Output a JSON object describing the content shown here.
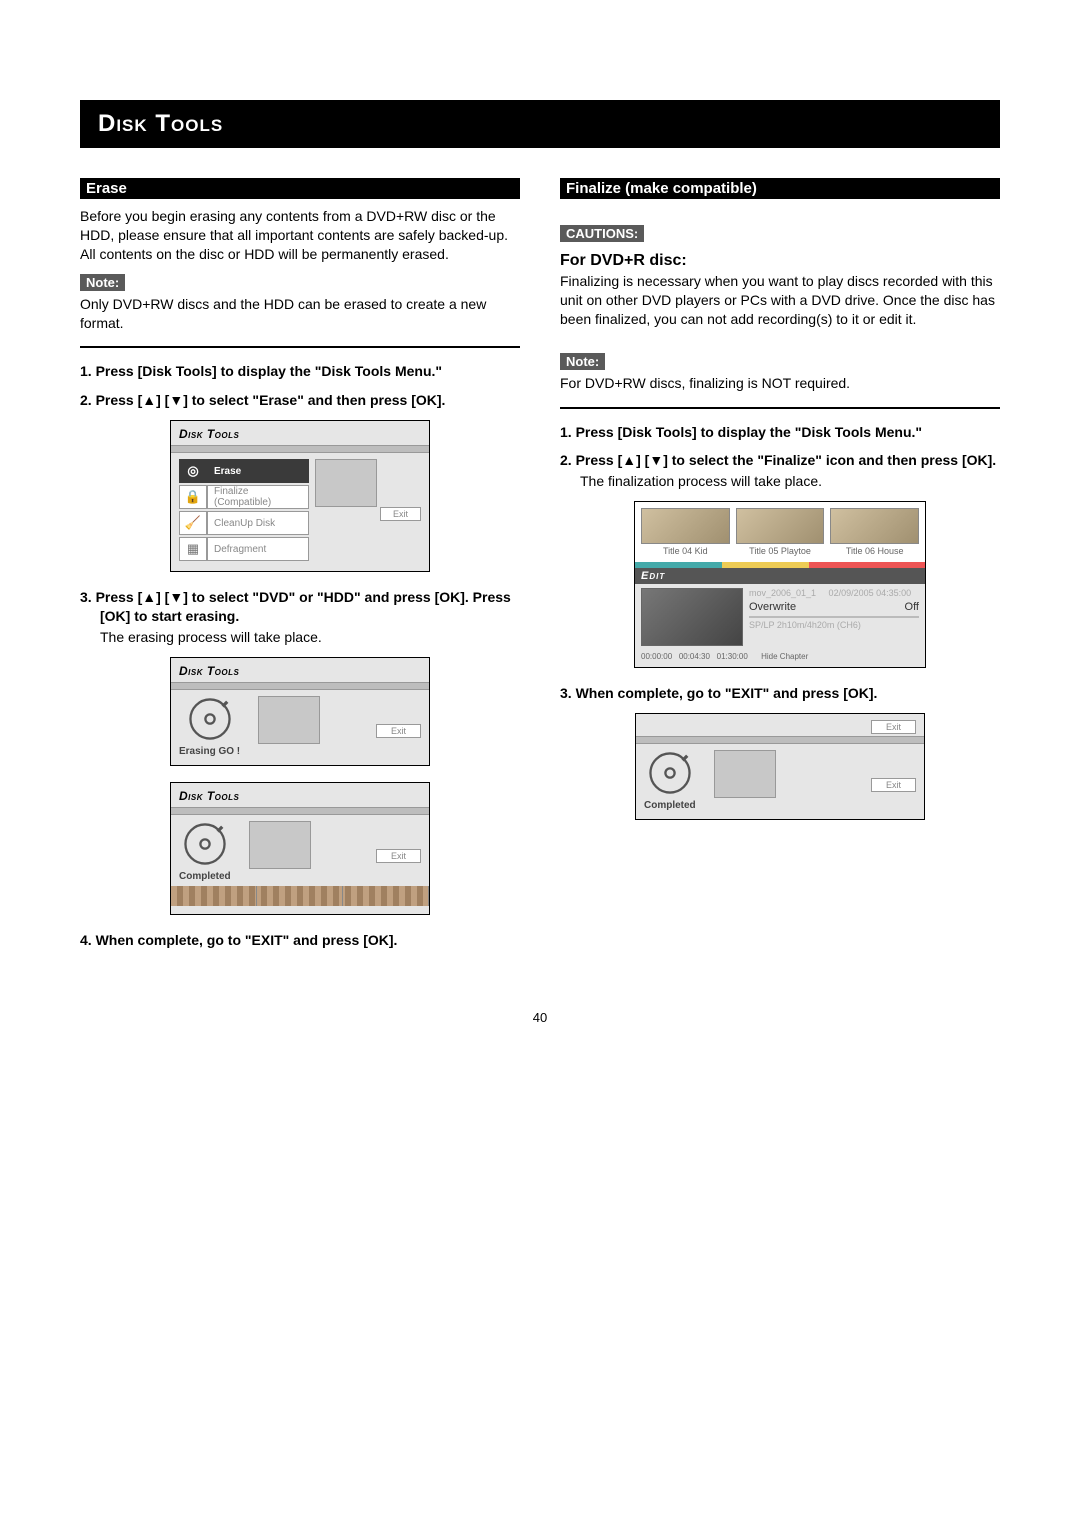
{
  "page_title": "Disk Tools",
  "page_number": "40",
  "erase": {
    "header": "Erase",
    "intro": "Before you begin erasing any contents from a DVD+RW disc or the HDD, please ensure that all important contents are safely backed-up. All contents on the disc or HDD will be permanently erased.",
    "note_label": "Note:",
    "note_text": "Only DVD+RW discs and the HDD can be erased to create a new format.",
    "steps": {
      "s1": "1.  Press [Disk Tools] to display the \"Disk Tools Menu.\"",
      "s2": "2.  Press [▲]  [▼] to select \"Erase\" and then press [OK].",
      "s3": "3.  Press  [▲]  [▼] to select \"DVD\" or \"HDD\" and press [OK].  Press [OK] to start erasing.",
      "s3_sub": "The erasing process will take place.",
      "s4": "4.  When complete, go to \"EXIT\" and press [OK]."
    },
    "ui_menu": {
      "title": "Disk Tools",
      "items": {
        "erase": "Erase",
        "finalize": "Finalize (Compatible)",
        "cleanup": "CleanUp Disk",
        "defrag": "Defragment"
      },
      "exit": "Exit"
    },
    "ui_status": {
      "title": "Disk Tools",
      "erasing": "Erasing GO !",
      "completed": "Completed",
      "exit": "Exit"
    }
  },
  "finalize": {
    "header": "Finalize (make compatible)",
    "cautions_label": "CAUTIONS:",
    "sub_heading": "For DVD+R disc:",
    "body": "Finalizing is necessary when you want to play discs recorded with this unit on other DVD players or PCs with a DVD drive. Once the disc has been finalized, you can not add recording(s) to it or edit it.",
    "note_label": "Note:",
    "note_text": "For DVD+RW discs, finalizing is NOT required.",
    "steps": {
      "s1": "1. Press [Disk Tools] to display the \"Disk Tools Menu.\"",
      "s2": "2. Press [▲]  [▼] to select the \"Finalize\" icon and then press [OK].",
      "s2_sub": "The finalization process will take place.",
      "s3": "3. When complete, go to \"EXIT\" and press [OK]."
    },
    "edit_shot": {
      "thumbs": {
        "t1": "Title 04 Kid",
        "t2": "Title 05 Playtoe",
        "t3": "Title 06 House"
      },
      "edit_label": "Edit",
      "overwrite": "Overwrite",
      "off": "Off",
      "hide_chapter": "Hide Chapter",
      "time_a": "00:00:00",
      "time_b": "00:04:30",
      "time_c": "01:30:00"
    },
    "ui_status": {
      "completed": "Completed",
      "exit": "Exit"
    }
  }
}
